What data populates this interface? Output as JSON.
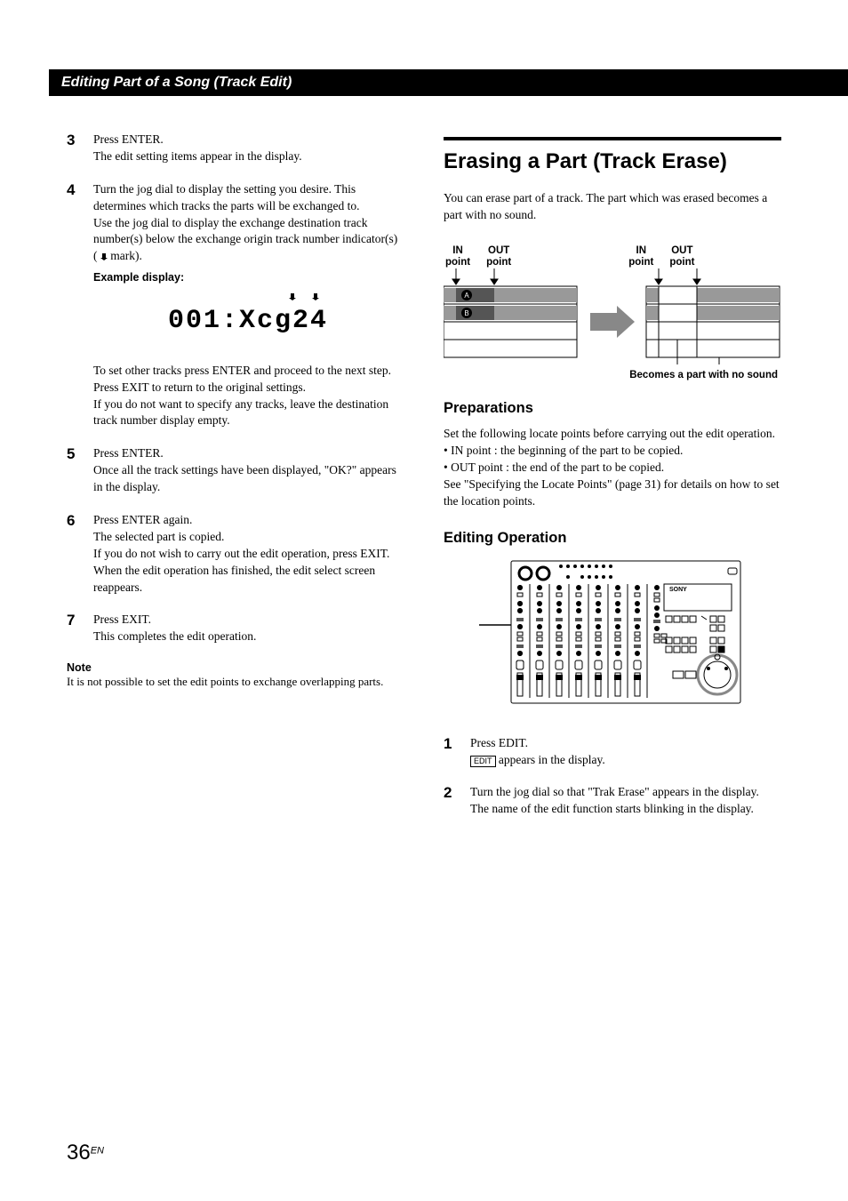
{
  "section_header": "Editing Part of a Song (Track Edit)",
  "left": {
    "step3": {
      "num": "3",
      "line1": "Press ENTER.",
      "line2": "The edit setting items appear in the display."
    },
    "step4": {
      "num": "4",
      "para1": "Turn the jog dial to display the setting you desire. This determines which tracks the parts will be exchanged to.",
      "para2": "Use the jog dial to display the exchange destination track number(s) below the exchange origin track number indicator(s) ( ",
      "para2_tail": "  mark).",
      "example_label": "Example display:",
      "lcd": "001:Xcg24",
      "after1": "To set other tracks press ENTER and proceed to the next step.",
      "after2": "Press EXIT to return to the original settings.",
      "after3": "If you do not want to specify any tracks, leave the destination track number display empty."
    },
    "step5": {
      "num": "5",
      "line1": "Press ENTER.",
      "line2": "Once all the track settings have been displayed, \"OK?\" appears in the display."
    },
    "step6": {
      "num": "6",
      "line1": "Press ENTER again.",
      "line2": "The selected part is copied.",
      "line3": "If you do not wish to carry out the edit operation, press EXIT.",
      "line4": "When the edit operation has finished, the edit select screen reappears."
    },
    "step7": {
      "num": "7",
      "line1": "Press EXIT.",
      "line2": "This completes the edit operation."
    },
    "note": {
      "heading": "Note",
      "body": "It is not possible to set the edit points to exchange overlapping parts."
    }
  },
  "right": {
    "title": "Erasing a Part (Track Erase)",
    "intro": "You can erase part of a track. The part which was erased becomes a part with no sound.",
    "diag": {
      "in_a": "IN\npoint",
      "out_a": "OUT\npoint",
      "in_b": "IN\npoint",
      "out_b": "OUT\npoint",
      "badge_a": "A",
      "badge_b": "B",
      "caption": "Becomes a part with no sound"
    },
    "prep": {
      "heading": "Preparations",
      "p1": "Set the following locate points before carrying out the edit operation.",
      "b1": "• IN point : the beginning of the part to be copied.",
      "b2": "• OUT point : the end of the part to be copied.",
      "p2": "See \"Specifying the Locate Points\" (page 31) for details on how to set the location points."
    },
    "editop": {
      "heading": "Editing Operation",
      "step1_num": "1",
      "step1_a": "Press EDIT.",
      "step1_key": "EDIT",
      "step1_b": " appears in the display.",
      "step2_num": "2",
      "step2_a": "Turn the jog dial so that \"Trak Erase\" appears in the display.",
      "step2_b": "The name of the edit function starts blinking in the display."
    }
  },
  "page": {
    "num": "36",
    "suffix": "EN"
  }
}
